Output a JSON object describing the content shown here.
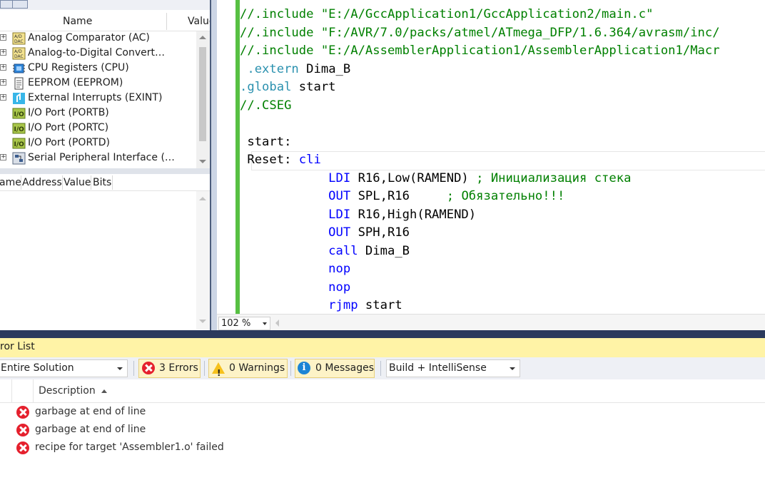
{
  "io_view": {
    "columns": {
      "name": "Name",
      "value": "Value"
    },
    "peripherals": [
      {
        "label": "Analog Comparator (AC)",
        "icon": "adc-dac-icon",
        "expandable": true
      },
      {
        "label": "Analog-to-Digital Convert…",
        "icon": "adc-dac-icon",
        "expandable": true
      },
      {
        "label": "CPU Registers (CPU)",
        "icon": "cpu-chip-icon",
        "expandable": true
      },
      {
        "label": "EEPROM (EEPROM)",
        "icon": "eeprom-icon",
        "expandable": true
      },
      {
        "label": "External Interrupts (EXINT)",
        "icon": "interrupt-icon",
        "expandable": true
      },
      {
        "label": "I/O Port (PORTB)",
        "icon": "io-port-icon",
        "expandable": false
      },
      {
        "label": "I/O Port (PORTC)",
        "icon": "io-port-icon",
        "expandable": false
      },
      {
        "label": "I/O Port (PORTD)",
        "icon": "io-port-icon",
        "expandable": false
      },
      {
        "label": "Serial Peripheral Interface (…",
        "icon": "spi-icon",
        "expandable": true
      }
    ],
    "register_columns": {
      "name": "ame",
      "address": "Address",
      "value": "Value",
      "bits": "Bits"
    }
  },
  "editor": {
    "zoom": "102 %",
    "lines": [
      [
        {
          "t": "//.include \"E:/A/GccApplication1/GccApplication2/main.c\"",
          "c": "com"
        }
      ],
      [
        {
          "t": "//.include \"F:/AVR/7.0/packs/atmel/ATmega_DFP/1.6.364/avrasm/inc/",
          "c": "com"
        }
      ],
      [
        {
          "t": "//.include \"E:/A/AssemblerApplication1/AssemblerApplication1/Macr",
          "c": "com"
        }
      ],
      [
        {
          "t": " .extern",
          "c": "dir"
        },
        {
          "t": " Dima_B",
          "c": "txt"
        }
      ],
      [
        {
          "t": ".global",
          "c": "dir"
        },
        {
          "t": " start",
          "c": "txt"
        }
      ],
      [
        {
          "t": "//.CSEG",
          "c": "com"
        }
      ],
      [
        {
          "t": "",
          "c": "txt"
        }
      ],
      [
        {
          "t": " start:",
          "c": "txt"
        }
      ],
      [
        {
          "t": " Reset: ",
          "c": "txt"
        },
        {
          "t": "cli",
          "c": "kw"
        }
      ],
      [
        {
          "t": "            LDI",
          "c": "kw"
        },
        {
          "t": " R16,Low(RAMEND) ",
          "c": "txt"
        },
        {
          "t": "; Инициализация стека",
          "c": "com"
        }
      ],
      [
        {
          "t": "            OUT",
          "c": "kw"
        },
        {
          "t": " SPL,R16     ",
          "c": "txt"
        },
        {
          "t": "; Обязательно!!!",
          "c": "com"
        }
      ],
      [
        {
          "t": "            LDI",
          "c": "kw"
        },
        {
          "t": " R16,High(RAMEND)",
          "c": "txt"
        }
      ],
      [
        {
          "t": "            OUT",
          "c": "kw"
        },
        {
          "t": " SPH,R16",
          "c": "txt"
        }
      ],
      [
        {
          "t": "            call",
          "c": "kw"
        },
        {
          "t": " Dima_B",
          "c": "txt"
        }
      ],
      [
        {
          "t": "            nop",
          "c": "kw"
        }
      ],
      [
        {
          "t": "            nop",
          "c": "kw"
        }
      ],
      [
        {
          "t": "            rjmp",
          "c": "kw"
        },
        {
          "t": " start",
          "c": "txt"
        }
      ]
    ]
  },
  "error_list": {
    "title": "ror List",
    "scope": "Entire Solution",
    "errors_label": "3 Errors",
    "warnings_label": "0 Warnings",
    "messages_label": "0 Messages",
    "build_filter": "Build + IntelliSense",
    "column_description": "Description",
    "rows": [
      {
        "description": "garbage at end of line",
        "icon": "error-icon"
      },
      {
        "description": "garbage at end of line",
        "icon": "error-icon"
      },
      {
        "description": "recipe for target 'Assembler1.o' failed",
        "icon": "error-icon"
      }
    ]
  },
  "colors": {
    "comment": "#008000",
    "keyword": "#0000ff",
    "directive": "#2b91af",
    "change_bar": "#57c043",
    "error_list_title_bg": "#fff3a6",
    "error_icon": "#e5202d"
  }
}
